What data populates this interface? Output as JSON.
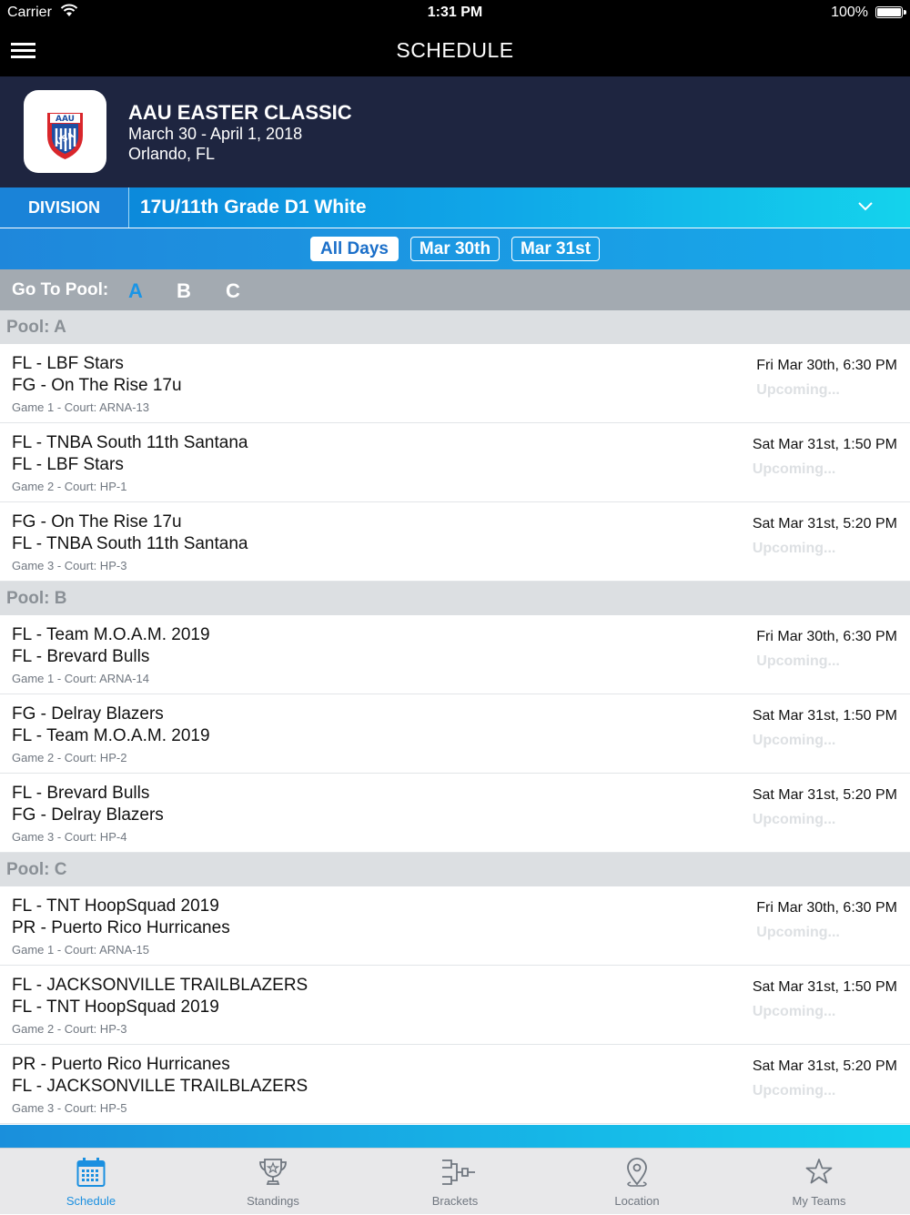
{
  "status_bar": {
    "carrier": "Carrier",
    "time": "1:31 PM",
    "battery": "100%"
  },
  "nav": {
    "title": "SCHEDULE"
  },
  "event": {
    "name": "AAU EASTER CLASSIC",
    "dates": "March 30 - April 1, 2018",
    "location": "Orlando, FL",
    "logo_text": "AAU USA"
  },
  "division": {
    "label": "DIVISION",
    "value": "17U/11th Grade D1 White"
  },
  "day_filter": [
    {
      "label": "All Days",
      "active": true
    },
    {
      "label": "Mar 30th",
      "active": false
    },
    {
      "label": "Mar 31st",
      "active": false
    }
  ],
  "pool_nav": {
    "label": "Go To Pool:",
    "pools": [
      "A",
      "B",
      "C"
    ],
    "active": "A"
  },
  "pools": [
    {
      "title": "Pool: A",
      "games": [
        {
          "team1": "FL - LBF Stars",
          "team2": "FG - On The Rise 17u",
          "info": "Game 1 - Court: ARNA-13",
          "time": "Fri Mar 30th, 6:30 PM",
          "status": "Upcoming..."
        },
        {
          "team1": "FL - TNBA South 11th Santana",
          "team2": "FL - LBF Stars",
          "info": "Game 2 - Court: HP-1",
          "time": "Sat Mar 31st, 1:50 PM",
          "status": "Upcoming..."
        },
        {
          "team1": "FG - On The Rise 17u",
          "team2": "FL - TNBA South 11th Santana",
          "info": "Game 3 - Court: HP-3",
          "time": "Sat Mar 31st, 5:20 PM",
          "status": "Upcoming..."
        }
      ]
    },
    {
      "title": "Pool: B",
      "games": [
        {
          "team1": "FL - Team M.O.A.M. 2019",
          "team2": "FL - Brevard Bulls",
          "info": "Game 1 - Court: ARNA-14",
          "time": "Fri Mar 30th, 6:30 PM",
          "status": "Upcoming..."
        },
        {
          "team1": "FG - Delray Blazers",
          "team2": "FL - Team M.O.A.M. 2019",
          "info": "Game 2 - Court: HP-2",
          "time": "Sat Mar 31st, 1:50 PM",
          "status": "Upcoming..."
        },
        {
          "team1": "FL - Brevard Bulls",
          "team2": "FG - Delray Blazers",
          "info": "Game 3 - Court: HP-4",
          "time": "Sat Mar 31st, 5:20 PM",
          "status": "Upcoming..."
        }
      ]
    },
    {
      "title": "Pool: C",
      "games": [
        {
          "team1": "FL - TNT HoopSquad 2019",
          "team2": "PR - Puerto Rico Hurricanes",
          "info": "Game 1 - Court: ARNA-15",
          "time": "Fri Mar 30th, 6:30 PM",
          "status": "Upcoming..."
        },
        {
          "team1": "FL - JACKSONVILLE TRAILBLAZERS",
          "team2": "FL - TNT HoopSquad 2019",
          "info": "Game 2 - Court: HP-3",
          "time": "Sat Mar 31st, 1:50 PM",
          "status": "Upcoming..."
        },
        {
          "team1": "PR - Puerto Rico Hurricanes",
          "team2": "FL - JACKSONVILLE TRAILBLAZERS",
          "info": "Game 3 - Court: HP-5",
          "time": "Sat Mar 31st, 5:20 PM",
          "status": "Upcoming..."
        }
      ]
    }
  ],
  "tabs": [
    {
      "label": "Schedule",
      "icon": "calendar-icon",
      "active": true
    },
    {
      "label": "Standings",
      "icon": "trophy-icon",
      "active": false
    },
    {
      "label": "Brackets",
      "icon": "bracket-icon",
      "active": false
    },
    {
      "label": "Location",
      "icon": "location-pin-icon",
      "active": false
    },
    {
      "label": "My Teams",
      "icon": "star-icon",
      "active": false
    }
  ],
  "colors": {
    "header_bg": "#1e2540",
    "accent": "#1a8fe0",
    "pool_header": "#dcdfe2",
    "status_text": "#dde0e3"
  }
}
